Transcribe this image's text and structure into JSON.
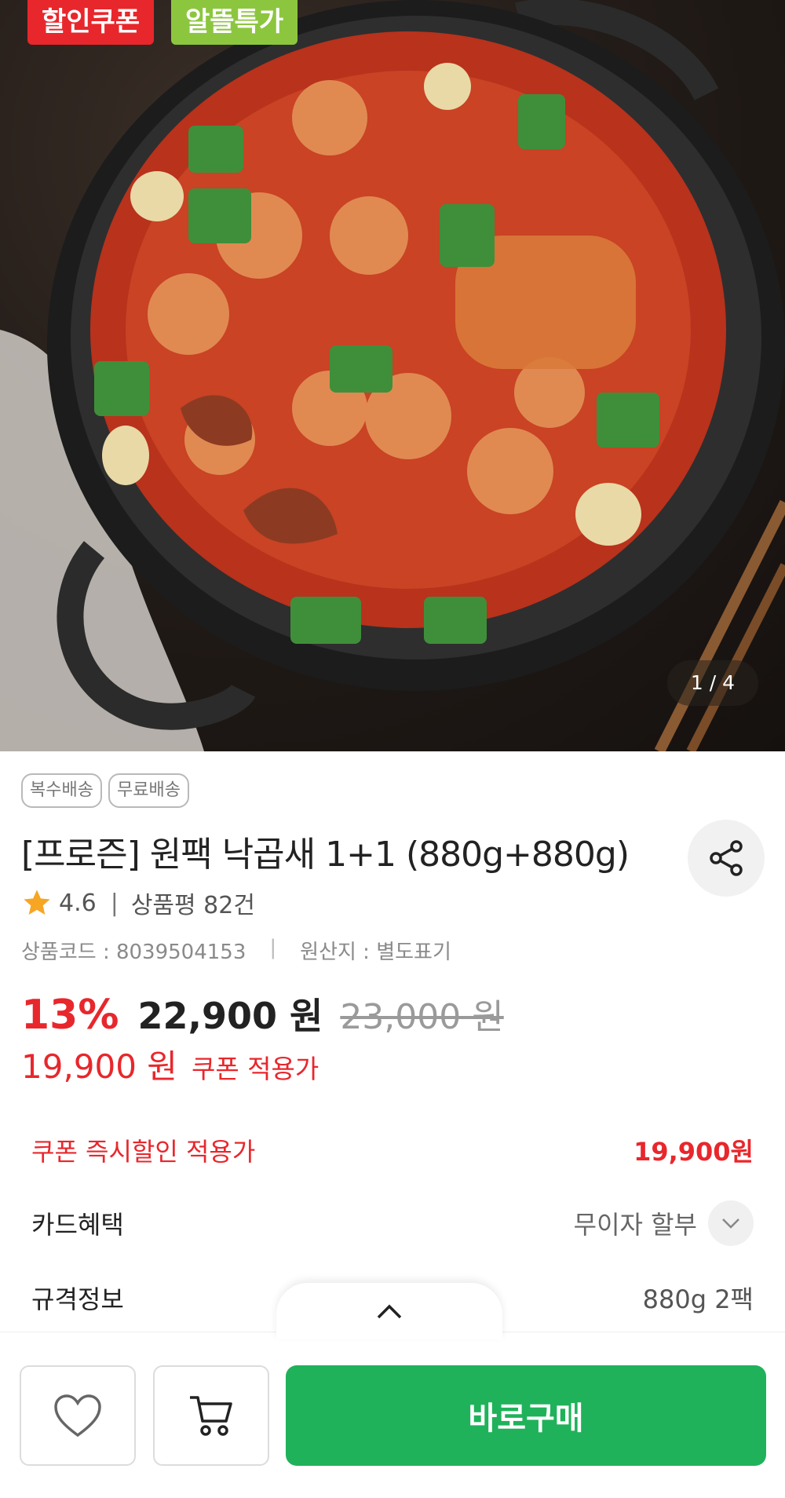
{
  "hero": {
    "badges": [
      "할인쿠폰",
      "알뜰특가"
    ],
    "page_indicator": "1 / 4"
  },
  "product": {
    "tags": [
      "복수배송",
      "무료배송"
    ],
    "title": "[프로즌] 원팩 낙곱새 1+1 (880g+880g)",
    "rating": "4.6",
    "review_label": "상품평 82건",
    "code_text": "상품코드 : 8039504153",
    "origin_text": "원산지 : 별도표기",
    "discount": "13%",
    "sale_price": "22,900 원",
    "original_price": "23,000 원",
    "coupon_price": "19,900 원",
    "coupon_label": "쿠폰 적용가"
  },
  "details": {
    "coupon_instant_label": "쿠폰 즉시할인 적용가",
    "coupon_instant_value": "19,900원",
    "card_label": "카드혜택",
    "card_value": "무이자 할부",
    "spec_label": "규격정보",
    "spec_value": "880g 2팩"
  },
  "bottom_bar": {
    "buy_label": "바로구매"
  },
  "colors": {
    "accent_red": "#e8272c",
    "buy_green": "#1fb25a",
    "deal_green": "#8cc63f",
    "star": "#f6a623"
  },
  "icons": [
    "share-icon",
    "star-icon",
    "chevron-down-icon",
    "chevron-up-icon",
    "heart-icon",
    "cart-icon"
  ]
}
